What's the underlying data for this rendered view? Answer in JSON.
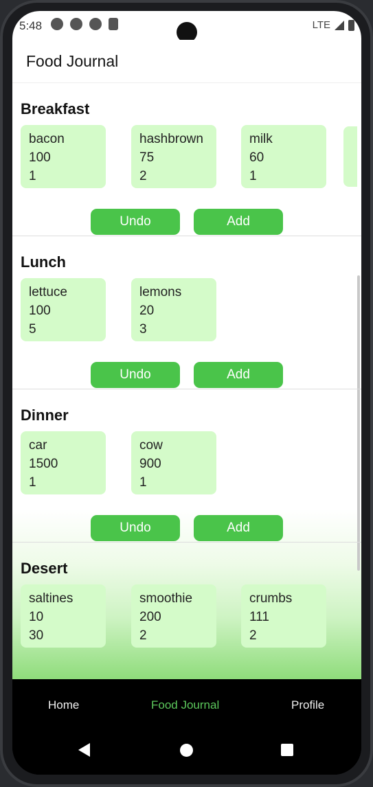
{
  "status_bar": {
    "time": "5:48",
    "network": "LTE",
    "icons": [
      "a-icon",
      "wifi-off-icon",
      "data-icon",
      "sd-card-icon"
    ]
  },
  "app_bar": {
    "title": "Food Journal"
  },
  "buttons": {
    "undo": "Undo",
    "add": "Add"
  },
  "meals": [
    {
      "name": "Breakfast",
      "items": [
        {
          "food": "bacon",
          "calories": "100",
          "quantity": "1"
        },
        {
          "food": "hashbrown",
          "calories": "75",
          "quantity": "2"
        },
        {
          "food": "milk",
          "calories": "60",
          "quantity": "1"
        }
      ]
    },
    {
      "name": "Lunch",
      "items": [
        {
          "food": "lettuce",
          "calories": "100",
          "quantity": "5"
        },
        {
          "food": "lemons",
          "calories": "20",
          "quantity": "3"
        }
      ]
    },
    {
      "name": "Dinner",
      "items": [
        {
          "food": "car",
          "calories": "1500",
          "quantity": "1"
        },
        {
          "food": "cow",
          "calories": "900",
          "quantity": "1"
        }
      ]
    },
    {
      "name": "Desert",
      "items": [
        {
          "food": "saltines",
          "calories": "10",
          "quantity": "30"
        },
        {
          "food": "smoothie",
          "calories": "200",
          "quantity": "2"
        },
        {
          "food": "crumbs",
          "calories": "111",
          "quantity": "2"
        }
      ]
    }
  ],
  "bottom_nav": {
    "items": [
      "Home",
      "Food Journal",
      "Profile"
    ],
    "active": "Food Journal",
    "active_color": "#5cc85c"
  },
  "colors": {
    "accent": "#4ac44a",
    "card": "#d4fbc9"
  }
}
